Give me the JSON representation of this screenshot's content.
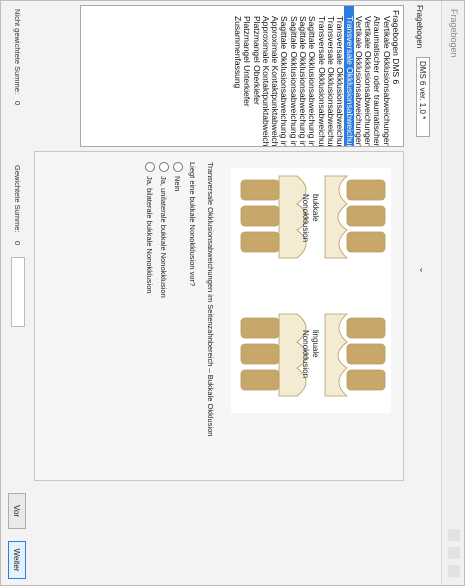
{
  "window": {
    "title": "Fragebogen"
  },
  "questionnaire": {
    "label": "Fragebogen",
    "selected": "DMS 6 ver. 1.0 *",
    "dropdown_icon": "chevron-down-icon"
  },
  "nav": {
    "items": [
      {
        "label": "Fragebogen DMS 6",
        "level": 0,
        "selected": false
      },
      {
        "label": "Vertikale Okklusionsabweichungen",
        "level": 1,
        "selected": false
      },
      {
        "label": "Atraumatischer oder traumatischer",
        "level": 1,
        "selected": false
      },
      {
        "label": "Vertikale Okklusionsabweichungen",
        "level": 1,
        "selected": false
      },
      {
        "label": "Vertikale Okklusionsabweichungen",
        "level": 1,
        "selected": false
      },
      {
        "label": "Transversale Okklusionsabweichur",
        "level": 1,
        "selected": true
      },
      {
        "label": "Transversale Okklusionsabweichur",
        "level": 1,
        "selected": false
      },
      {
        "label": "Transversale Okklusionsabweichur",
        "level": 1,
        "selected": false
      },
      {
        "label": "Transversale Okklusionsabweichur",
        "level": 1,
        "selected": false
      },
      {
        "label": "Sagittale Okklusionsabweichung in",
        "level": 1,
        "selected": false
      },
      {
        "label": "Sagittale Okklusionsabweichung in",
        "level": 1,
        "selected": false
      },
      {
        "label": "Sagittale Okklusionsabweichung in",
        "level": 1,
        "selected": false
      },
      {
        "label": "Sagittale Okklusionsabweichung in",
        "level": 1,
        "selected": false
      },
      {
        "label": "Approximale Kontaktpunktabweich",
        "level": 1,
        "selected": false
      },
      {
        "label": "Approximale Kontaktpunktabweich",
        "level": 1,
        "selected": false
      },
      {
        "label": "Platzmangel Oberkiefer",
        "level": 1,
        "selected": false
      },
      {
        "label": "Platzmangel Unterkiefer",
        "level": 1,
        "selected": false
      },
      {
        "label": "Zusammenfassung",
        "level": 1,
        "selected": false
      }
    ]
  },
  "question": {
    "illustration_labels": {
      "left_line1": "bukkale",
      "left_line2": "Nonokklusion",
      "right_line1": "linguale",
      "right_line2": "Nonokklusion"
    },
    "title": "Transversale Okklusionsabweichungen im Seitenzahnbereich – Bukkale Okklusion",
    "prompt": "Liegt eine bukkale Nonokklusion vor?",
    "options": [
      "Nein",
      "Ja, unilaterale bukkale Nonokklusion",
      "Ja, bilaterale bukkale Nonokklusion"
    ]
  },
  "footer": {
    "unweighted_label": "Nicht gewichtete Summe:",
    "unweighted_value": "0",
    "weighted_label": "Gewichtete Summe:",
    "weighted_value": "0",
    "back_label": "Vor",
    "next_label": "Weiter"
  },
  "colors": {
    "selection": "#2b7de1",
    "tooth": "#f4ecd2",
    "root": "#c8a86a"
  }
}
